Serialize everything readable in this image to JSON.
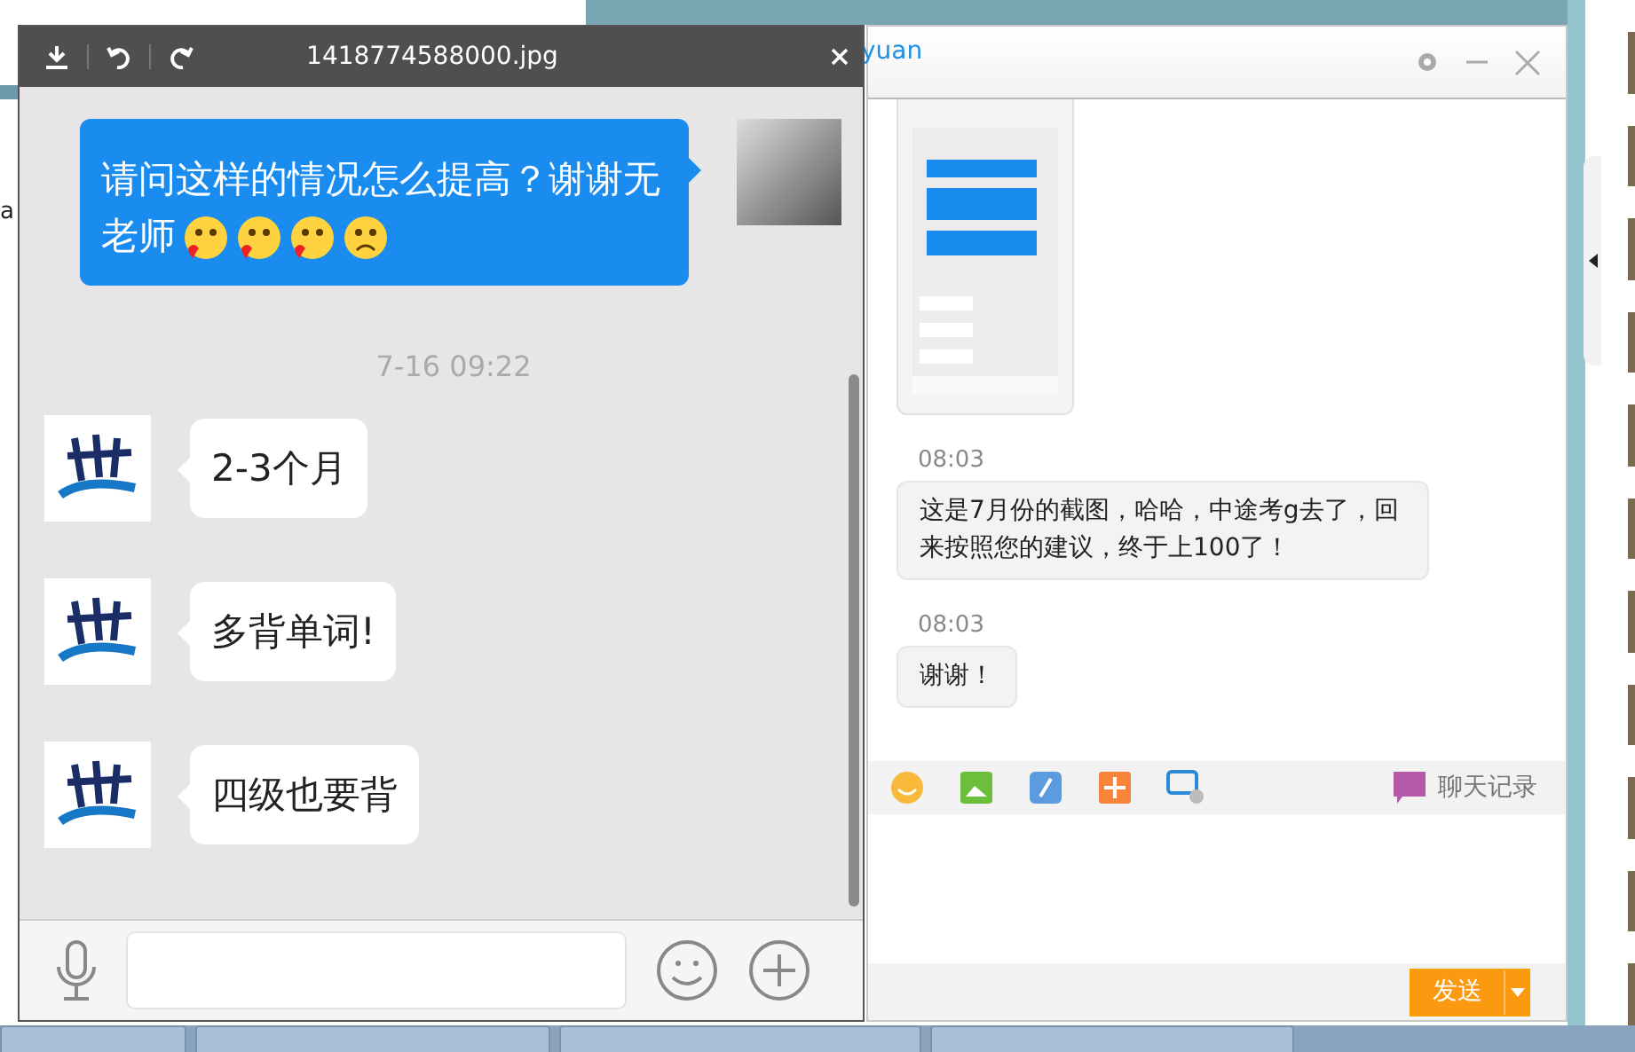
{
  "background_fragment": "a",
  "chat_window": {
    "title": "yuan",
    "messages": [
      {
        "kind": "image"
      },
      {
        "kind": "text",
        "time": "08:03",
        "text": "这是7月份的截图，哈哈，中途考g去了，回来按照您的建议，终于上100了！"
      },
      {
        "kind": "text",
        "time": "08:03",
        "text": "谢谢！"
      }
    ],
    "history_label": "聊天记录",
    "send_button": "发送"
  },
  "image_viewer": {
    "title": "1418774588000.jpg",
    "outgoing_message": "请问这样的情况怎么提高？谢谢无老师",
    "time": "7-16 09:22",
    "incoming_messages": [
      "2-3个月",
      "多背单词!",
      "四级也要背"
    ]
  }
}
